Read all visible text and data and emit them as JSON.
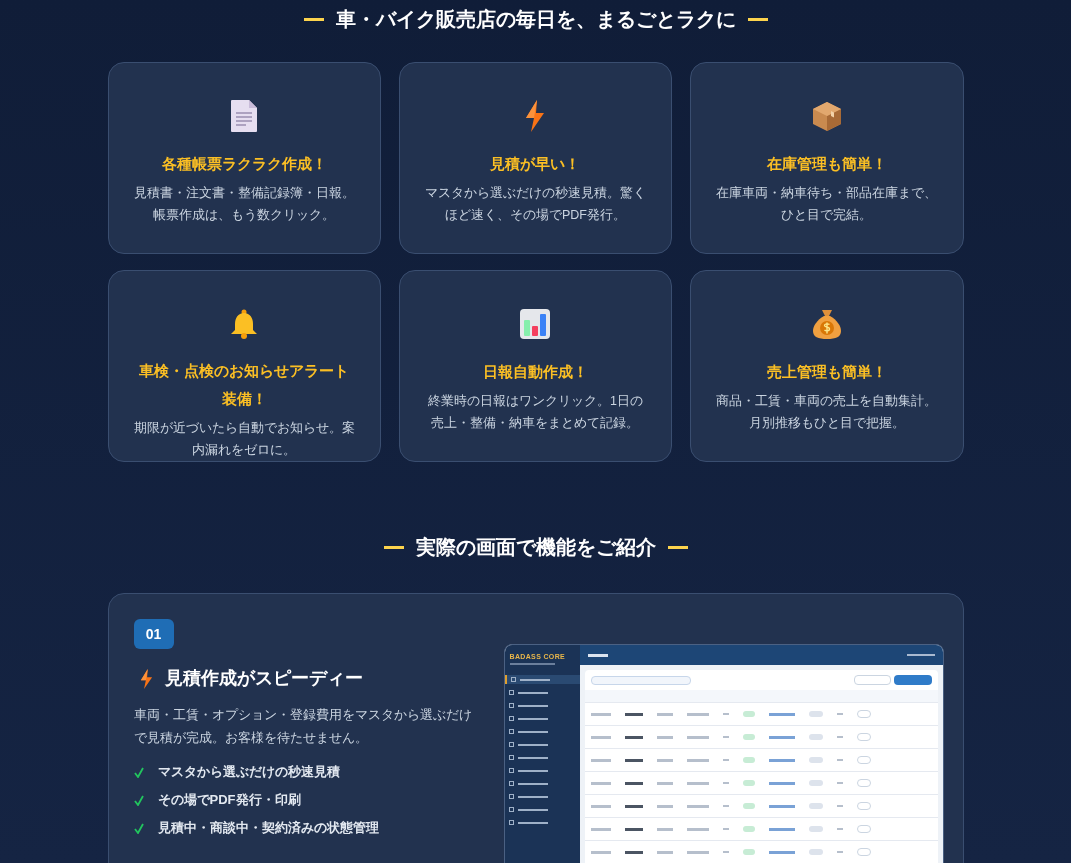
{
  "heading": "車・バイク販売店の毎日を、まるごとラクに",
  "features": [
    {
      "kind": "document",
      "title": "各種帳票ラクラク作成！",
      "description": "見積書・注文書・整備記録簿・日報。帳票作成は、もう数クリック。"
    },
    {
      "kind": "lightning",
      "title": "見積が早い！",
      "description": "マスタから選ぶだけの秒速見積。驚くほど速く、その場でPDF発行。"
    },
    {
      "kind": "box",
      "title": "在庫管理も簡単！",
      "description": "在庫車両・納車待ち・部品在庫まで、ひと目で完結。"
    },
    {
      "kind": "bell",
      "title": "車検・点検のお知らせアラート装備！",
      "description": "期限が近づいたら自動でお知らせ。案内漏れをゼロに。"
    },
    {
      "kind": "chart",
      "title": "日報自動作成！",
      "description": "終業時の日報はワンクリック。1日の売上・整備・納車をまとめて記録。"
    },
    {
      "kind": "moneybag",
      "title": "売上管理も簡単！",
      "description": "商品・工賃・車両の売上を自動集計。月別推移もひと目で把握。"
    }
  ],
  "showcase": {
    "heading": "実際の画面で機能をご紹介",
    "items": [
      {
        "number": "01",
        "kind": "lightning",
        "title": "見積作成がスピーディー",
        "description": "車両・工賃・オプション・登録費用をマスタから選ぶだけで見積が完成。お客様を待たせません。",
        "points": [
          "マスタから選ぶだけの秒速見積",
          "その場でPDF発行・印刷",
          "見積中・商談中・契約済みの状態管理"
        ],
        "screenshot": {
          "brand": "BADASS CORE"
        }
      }
    ]
  }
}
